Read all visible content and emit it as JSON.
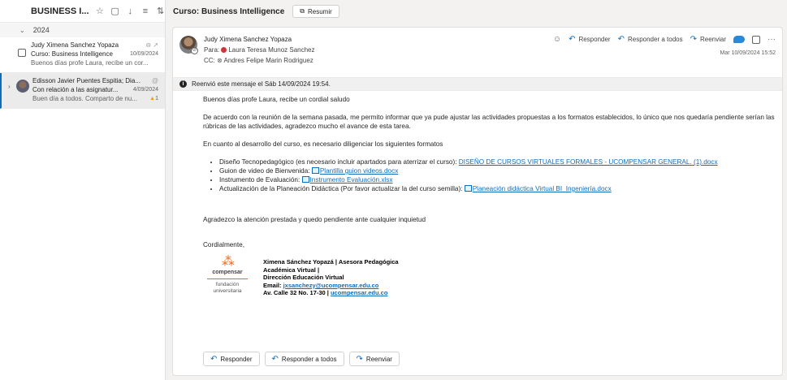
{
  "list": {
    "folder_title": "BUSINESS I...",
    "group_label": "2024",
    "items": [
      {
        "sender": "Judy Ximena Sanchez Yopaza",
        "subject": "Curso: Business Intelligence",
        "date": "10/09/2024",
        "preview": "Buenos días profe Laura, recibe un cor..."
      },
      {
        "sender": "Edisson Javier Puentes Espitia; Dia...",
        "subject": "Con relación a las asignatur...",
        "date": "4/09/2024",
        "preview": "Buen día a todos. Comparto de nu...",
        "count": "1"
      }
    ]
  },
  "reading": {
    "subject": "Curso: Business Intelligence",
    "summarize_label": "Resumir",
    "sender": "Judy Ximena Sanchez Yopaza",
    "to_label": "Para:",
    "to_value": "Laura Teresa Munoz Sanchez",
    "cc_label": "CC:",
    "cc_value": "Andres Felipe Marin Rodriguez",
    "reply_label": "Responder",
    "reply_all_label": "Responder a todos",
    "forward_label": "Reenviar",
    "date": "Mar 10/09/2024 15:52",
    "info_text": "Reenvió este mensaje el Sáb 14/09/2024 19:54.",
    "body": {
      "greeting": "Buenos días profe Laura, recibe un cordial saludo",
      "para1": "De acuerdo con la reunión de la semana pasada, me permito informar que ya pude ajustar las actividades propuestas a los formatos establecidos, lo único que nos quedaría pendiente serían las rúbricas de las actividades, agradezco mucho el avance de esta tarea.",
      "para2": "En cuanto al desarrollo del curso, es necesario diligenciar los siguientes formatos",
      "list": [
        {
          "text": "Diseño Tecnopedagógico (es necesario incluir apartados para aterrizar el curso): ",
          "link": "DISEÑO DE CURSOS VIRTUALES FORMALES - UCOMPENSAR GENERAL. (1).docx",
          "attach": false
        },
        {
          "text": "Guion de video de Bienvenida: ",
          "link": "Plantilla guion videos.docx",
          "attach": true
        },
        {
          "text": "Instrumento de Evaluación: ",
          "link": "Instrumento Evaluación.xlsx",
          "attach": true
        },
        {
          "text": "Actualización de la Planeación Didáctica (Por favor actualizar la del curso semilla): ",
          "link": "Planeación didáctica Virtual BI_Ingeniería.docx",
          "attach": true
        }
      ],
      "closing1": "Agradezco la atención prestada y quedo pendiente ante cualquier inquietud",
      "closing2": "Cordialmente,"
    },
    "signature": {
      "logo_name": "compensar",
      "logo_sub1": "fundación",
      "logo_sub2": "universitaria",
      "line1": "Ximena Sánchez Yopazá | Asesora Pedagógica",
      "line2": "Académica Virtual |",
      "line3": "Dirección Educación Virtual",
      "email_label": "Email: ",
      "email": "jxsanchezy@ucompensar.edu.co",
      "address": "Av. Calle 32 No. 17-30 | ",
      "site": "ucompensar.edu.co"
    }
  },
  "colors": {
    "accent": "#0f6cbd",
    "brand_orange": "#ea6a1c",
    "status_red": "#d13438"
  }
}
